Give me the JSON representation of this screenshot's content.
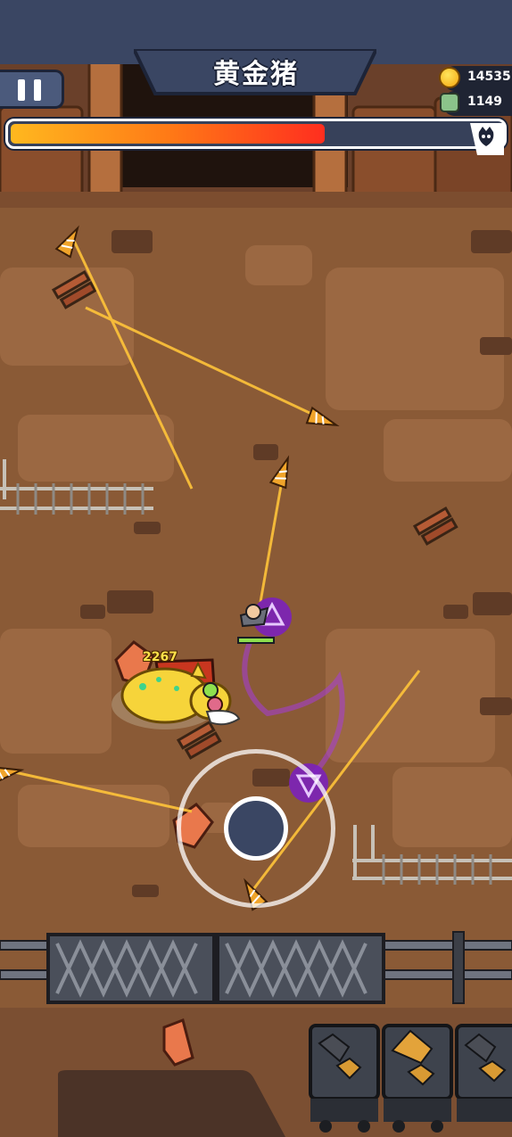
{
  "hud": {
    "boss_name": "黄金猪",
    "coins": "14535",
    "kills": "1149",
    "boss_hp_fraction": 0.64
  },
  "combat": {
    "damage_number": "2267"
  },
  "icons": {
    "pause": "pause-icon",
    "coin": "coin-icon",
    "kill": "zombie-skull-icon",
    "boss": "cat-skull-icon"
  },
  "colors": {
    "hud_navy": "#3a4663",
    "hp_start": "#ffb81f",
    "hp_end": "#ff2e1f",
    "ground": "#8a5a36",
    "purple_blade": "#8d2bd6",
    "damage_text": "#ffe14a"
  }
}
